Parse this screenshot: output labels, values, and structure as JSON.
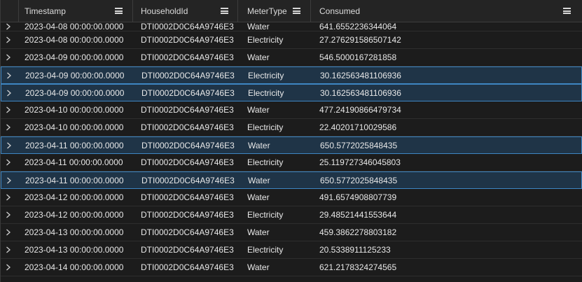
{
  "columns": [
    {
      "label": "Timestamp"
    },
    {
      "label": "HouseholdId"
    },
    {
      "label": "MeterType"
    },
    {
      "label": "Consumed"
    }
  ],
  "rows": [
    {
      "timestamp": "2023-04-08 00:00:00.0000",
      "household_id": "DTI0002D0C64A9746E3",
      "meter_type": "Water",
      "consumed": "641.6552236344064",
      "selected": false
    },
    {
      "timestamp": "2023-04-08 00:00:00.0000",
      "household_id": "DTI0002D0C64A9746E3",
      "meter_type": "Electricity",
      "consumed": "27.276291586507142",
      "selected": false
    },
    {
      "timestamp": "2023-04-09 00:00:00.0000",
      "household_id": "DTI0002D0C64A9746E3",
      "meter_type": "Water",
      "consumed": "546.5000167281858",
      "selected": false
    },
    {
      "timestamp": "2023-04-09 00:00:00.0000",
      "household_id": "DTI0002D0C64A9746E3",
      "meter_type": "Electricity",
      "consumed": "30.162563481106936",
      "selected": true
    },
    {
      "timestamp": "2023-04-09 00:00:00.0000",
      "household_id": "DTI0002D0C64A9746E3",
      "meter_type": "Electricity",
      "consumed": "30.162563481106936",
      "selected": true
    },
    {
      "timestamp": "2023-04-10 00:00:00.0000",
      "household_id": "DTI0002D0C64A9746E3",
      "meter_type": "Water",
      "consumed": "477.24190866479734",
      "selected": false
    },
    {
      "timestamp": "2023-04-10 00:00:00.0000",
      "household_id": "DTI0002D0C64A9746E3",
      "meter_type": "Electricity",
      "consumed": "22.40201710029586",
      "selected": false
    },
    {
      "timestamp": "2023-04-11 00:00:00.0000",
      "household_id": "DTI0002D0C64A9746E3",
      "meter_type": "Water",
      "consumed": "650.5772025848435",
      "selected": true
    },
    {
      "timestamp": "2023-04-11 00:00:00.0000",
      "household_id": "DTI0002D0C64A9746E3",
      "meter_type": "Electricity",
      "consumed": "25.119727346045803",
      "selected": false
    },
    {
      "timestamp": "2023-04-11 00:00:00.0000",
      "household_id": "DTI0002D0C64A9746E3",
      "meter_type": "Water",
      "consumed": "650.5772025848435",
      "selected": true
    },
    {
      "timestamp": "2023-04-12 00:00:00.0000",
      "household_id": "DTI0002D0C64A9746E3",
      "meter_type": "Water",
      "consumed": "491.6574908807739",
      "selected": false
    },
    {
      "timestamp": "2023-04-12 00:00:00.0000",
      "household_id": "DTI0002D0C64A9746E3",
      "meter_type": "Electricity",
      "consumed": "29.48521441553644",
      "selected": false
    },
    {
      "timestamp": "2023-04-13 00:00:00.0000",
      "household_id": "DTI0002D0C64A9746E3",
      "meter_type": "Water",
      "consumed": "459.3862278803182",
      "selected": false
    },
    {
      "timestamp": "2023-04-13 00:00:00.0000",
      "household_id": "DTI0002D0C64A9746E3",
      "meter_type": "Electricity",
      "consumed": "20.5338911125233",
      "selected": false
    },
    {
      "timestamp": "2023-04-14 00:00:00.0000",
      "household_id": "DTI0002D0C64A9746E3",
      "meter_type": "Water",
      "consumed": "621.2178324274565",
      "selected": false
    }
  ],
  "icons": {
    "column_menu": "menu-icon",
    "row_expander": "chevron-right-icon"
  },
  "colors": {
    "selection_border": "#3e86c3",
    "selection_background": "#1f3447"
  }
}
